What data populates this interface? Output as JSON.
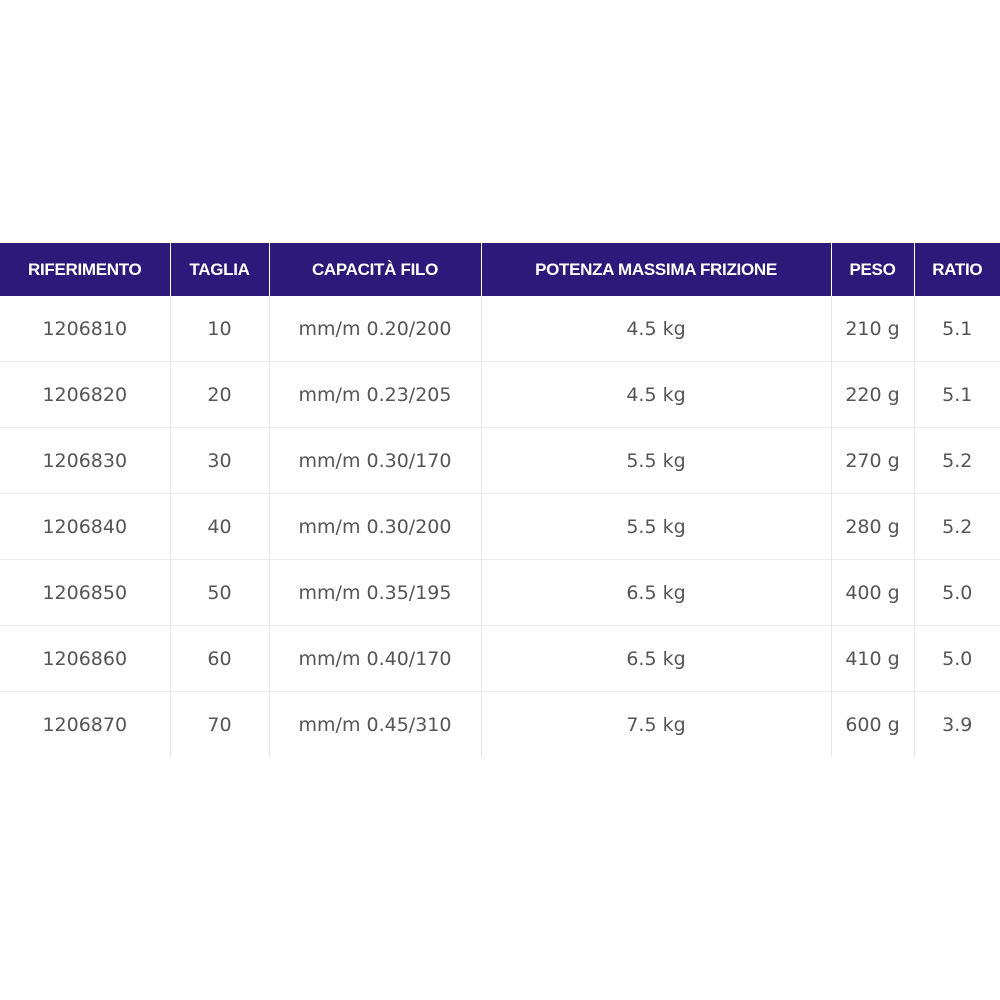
{
  "table": {
    "headers": [
      "RIFERIMENTO",
      "TAGLIA",
      "CAPACITÀ FILO",
      "POTENZA MASSIMA FRIZIONE",
      "PESO",
      "RATIO"
    ],
    "rows": [
      [
        "1206810",
        "10",
        "mm/m 0.20/200",
        "4.5 kg",
        "210 g",
        "5.1"
      ],
      [
        "1206820",
        "20",
        "mm/m 0.23/205",
        "4.5 kg",
        "220 g",
        "5.1"
      ],
      [
        "1206830",
        "30",
        "mm/m 0.30/170",
        "5.5 kg",
        "270 g",
        "5.2"
      ],
      [
        "1206840",
        "40",
        "mm/m 0.30/200",
        "5.5 kg",
        "280 g",
        "5.2"
      ],
      [
        "1206850",
        "50",
        "mm/m 0.35/195",
        "6.5 kg",
        "400 g",
        "5.0"
      ],
      [
        "1206860",
        "60",
        "mm/m 0.40/170",
        "6.5 kg",
        "410 g",
        "5.0"
      ],
      [
        "1206870",
        "70",
        "mm/m 0.45/310",
        "7.5 kg",
        "600 g",
        "3.9"
      ]
    ]
  },
  "colors": {
    "header_background": "#2b1a7a",
    "header_text": "#ffffff",
    "cell_text": "#555555"
  }
}
